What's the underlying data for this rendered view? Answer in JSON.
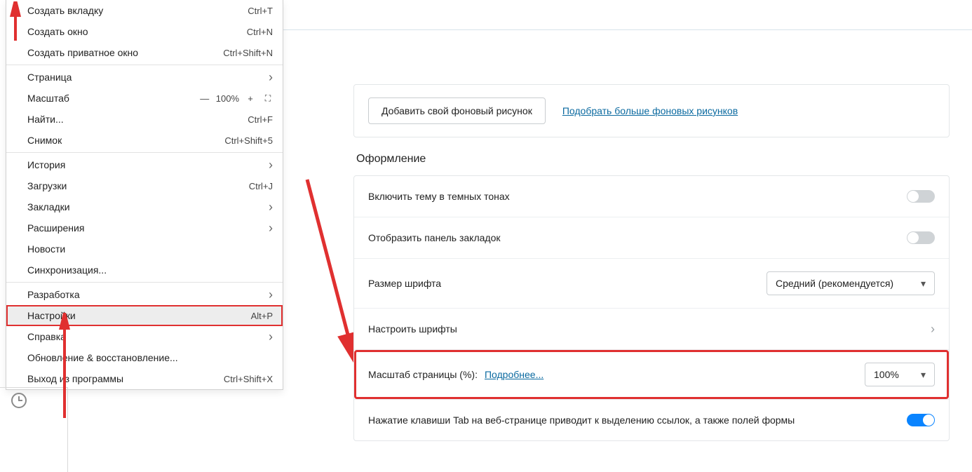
{
  "menu": {
    "items": [
      {
        "label": "Создать вкладку",
        "shortcut": "Ctrl+T",
        "type": "plain"
      },
      {
        "label": "Создать окно",
        "shortcut": "Ctrl+N",
        "type": "plain"
      },
      {
        "label": "Создать приватное окно",
        "shortcut": "Ctrl+Shift+N",
        "type": "plain"
      },
      {
        "type": "sep"
      },
      {
        "label": "Страница",
        "type": "submenu"
      },
      {
        "label": "Масштаб",
        "type": "zoom",
        "zoom_minus": "—",
        "zoom_value": "100%",
        "zoom_plus": "+",
        "zoom_full": "⛶"
      },
      {
        "label": "Найти...",
        "shortcut": "Ctrl+F",
        "type": "plain"
      },
      {
        "label": "Снимок",
        "shortcut": "Ctrl+Shift+5",
        "type": "plain"
      },
      {
        "type": "sep"
      },
      {
        "label": "История",
        "type": "submenu"
      },
      {
        "label": "Загрузки",
        "shortcut": "Ctrl+J",
        "type": "plain"
      },
      {
        "label": "Закладки",
        "type": "submenu"
      },
      {
        "label": "Расширения",
        "type": "submenu"
      },
      {
        "label": "Новости",
        "type": "plain"
      },
      {
        "label": "Синхронизация...",
        "type": "plain"
      },
      {
        "type": "sep"
      },
      {
        "label": "Разработка",
        "type": "submenu"
      },
      {
        "label": "Настройки",
        "shortcut": "Alt+P",
        "type": "plain",
        "highlight": true
      },
      {
        "label": "Справка",
        "type": "submenu"
      },
      {
        "label": "Обновление & восстановление...",
        "type": "plain"
      },
      {
        "label": "Выход из программы",
        "shortcut": "Ctrl+Shift+X",
        "type": "plain"
      }
    ]
  },
  "settings": {
    "bg_button": "Добавить свой фоновый рисунок",
    "bg_link": "Подобрать больше фоновых рисунков",
    "section_title": "Оформление",
    "dark_theme": "Включить тему в темных тонах",
    "show_bookmarks": "Отобразить панель закладок",
    "font_size_label": "Размер шрифта",
    "font_size_value": "Средний (рекомендуется)",
    "adjust_fonts": "Настроить шрифты",
    "page_zoom_label": "Масштаб страницы (%):",
    "page_zoom_more": "Подробнее...",
    "page_zoom_value": "100%",
    "tab_focus": "Нажатие клавиши Tab на веб-странице приводит к выделению ссылок, а также полей формы"
  }
}
